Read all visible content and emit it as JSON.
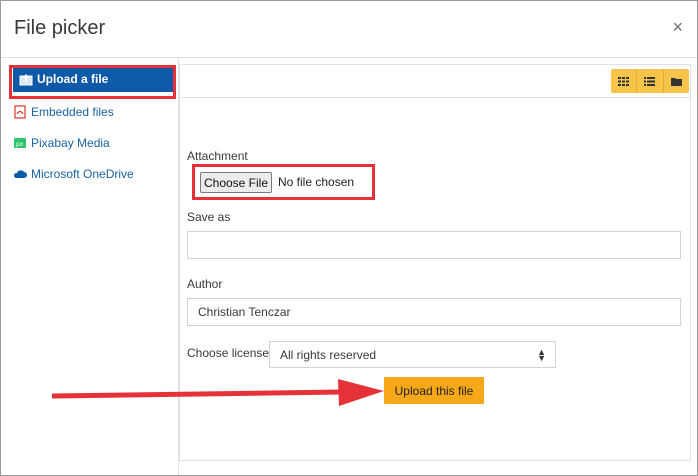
{
  "dialog": {
    "title": "File picker",
    "close_glyph": "×"
  },
  "sidebar": {
    "items": [
      {
        "label": "Upload a file",
        "icon": "upload-icon"
      },
      {
        "label": "Embedded files",
        "icon": "pdf-icon"
      },
      {
        "label": "Pixabay Media",
        "icon": "pixabay-icon"
      },
      {
        "label": "Microsoft OneDrive",
        "icon": "cloud-icon"
      }
    ]
  },
  "toolbar": {
    "views": [
      "grid-view-icon",
      "list-view-icon",
      "folder-view-icon"
    ],
    "accent": "#f7c44b"
  },
  "form": {
    "attachment_label": "Attachment",
    "choose_file_label": "Choose File",
    "no_file_text": "No file chosen",
    "save_as_label": "Save as",
    "save_as_value": "",
    "author_label": "Author",
    "author_value": "Christian Tenczar",
    "license_label": "Choose license",
    "license_value": "All rights reserved",
    "upload_button": "Upload this file"
  },
  "colors": {
    "active_item": "#0f5aa8",
    "upload_button": "#f7a818",
    "highlight": "#e53238"
  }
}
